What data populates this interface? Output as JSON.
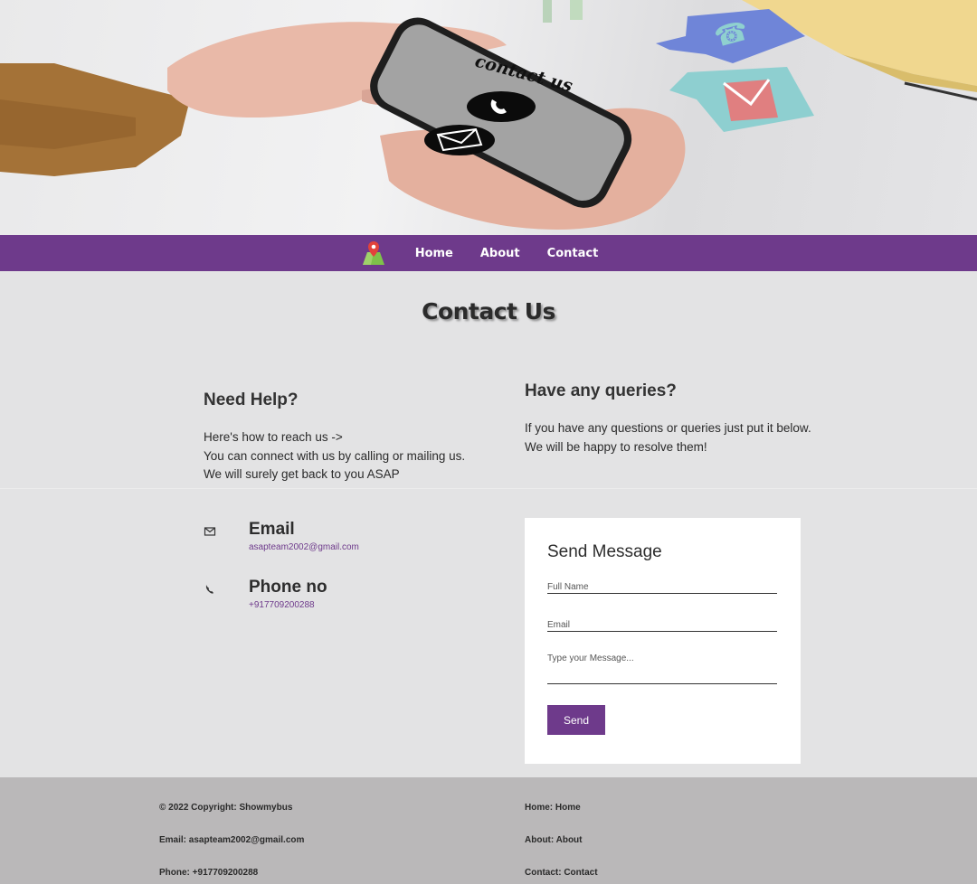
{
  "hero": {
    "phone_text": "contact us",
    "colors": {
      "phone_screen": "#a3a3a3",
      "phone_frame": "#1e1e1e",
      "bubble_blue": "#6f85d8",
      "bubble_teal": "#8ecfd0",
      "bubble_envelope": "#e07f80",
      "skin": "#e9b9a8",
      "sleeve": "#a47237",
      "notebook": "#f0d78f"
    }
  },
  "nav": {
    "logo_icon": "map-pin-icon",
    "links": [
      "Home",
      "About",
      "Contact"
    ],
    "color": "#6e3a8b"
  },
  "page_title": "Contact Us",
  "help": {
    "heading": "Need Help?",
    "lines": [
      "Here's how to reach us ->",
      "You can connect with us by calling or mailing us.",
      "We will surely get back to you ASAP"
    ]
  },
  "queries": {
    "heading": "Have any queries?",
    "lines": [
      "If you have any questions or queries just put it below.",
      "We will be happy to resolve them!"
    ]
  },
  "contact_info": {
    "email": {
      "icon": "envelope-icon",
      "label": "Email",
      "value": "asapteam2002@gmail.com"
    },
    "phone": {
      "icon": "phone-icon",
      "label": "Phone no",
      "value": "+917709200288"
    }
  },
  "form": {
    "heading": "Send Message",
    "full_name_placeholder": "Full Name",
    "email_placeholder": "Email",
    "message_placeholder": "Type your Message...",
    "send_label": "Send"
  },
  "footer": {
    "copyright": "© 2022 Copyright: Showmybus",
    "email": "Email: asapteam2002@gmail.com",
    "phone": "Phone: +917709200288",
    "home": "Home: Home",
    "about": "About: About",
    "contact": "Contact: Contact"
  }
}
